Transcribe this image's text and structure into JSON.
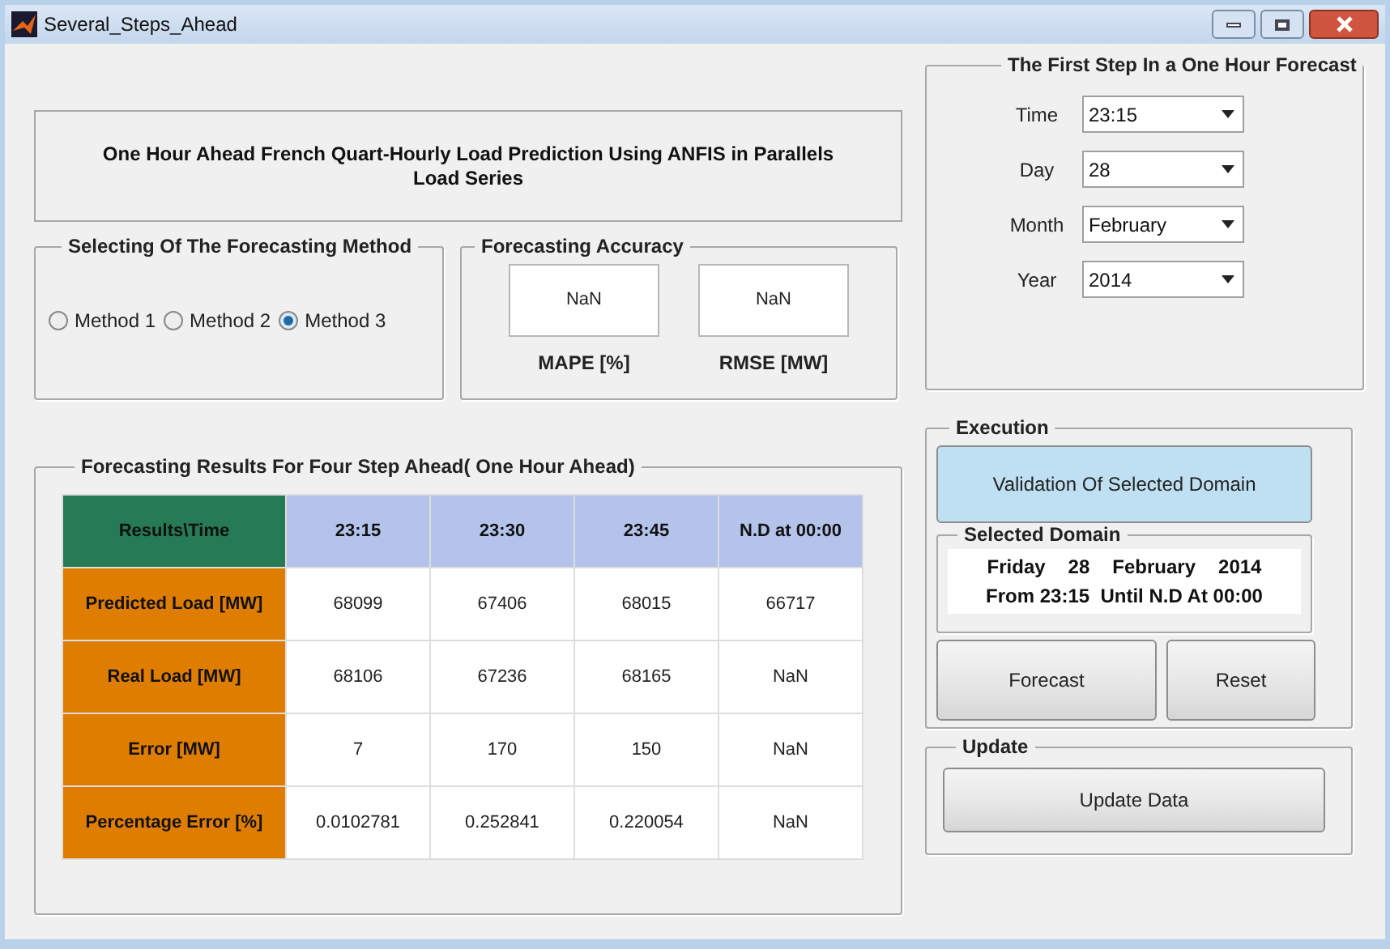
{
  "window": {
    "title": "Several_Steps_Ahead"
  },
  "heading": "One Hour Ahead French Quart-Hourly Load Prediction Using ANFIS in Parallels Load Series",
  "method_group": {
    "title": "Selecting Of The Forecasting Method",
    "options": [
      {
        "label": "Method 1",
        "selected": false
      },
      {
        "label": "Method 2",
        "selected": false
      },
      {
        "label": "Method 3",
        "selected": true
      }
    ]
  },
  "accuracy_group": {
    "title": "Forecasting Accuracy",
    "metrics": [
      {
        "value": "NaN",
        "label": "MAPE [%]"
      },
      {
        "value": "NaN",
        "label": "RMSE [MW]"
      }
    ]
  },
  "results_group": {
    "title": "Forecasting Results For Four Step Ahead( One Hour Ahead)",
    "table": {
      "corner": "Results\\Time",
      "columns": [
        "23:15",
        "23:30",
        "23:45",
        "N.D at 00:00"
      ],
      "rows": [
        {
          "label": "Predicted Load [MW]",
          "cells": [
            "68099",
            "67406",
            "68015",
            "66717"
          ]
        },
        {
          "label": "Real Load [MW]",
          "cells": [
            "68106",
            "67236",
            "68165",
            "NaN"
          ]
        },
        {
          "label": "Error [MW]",
          "cells": [
            "7",
            "170",
            "150",
            "NaN"
          ]
        },
        {
          "label": "Percentage Error [%]",
          "cells": [
            "0.0102781",
            "0.252841",
            "0.220054",
            "NaN"
          ]
        }
      ]
    }
  },
  "first_step_group": {
    "title": "The First Step In a One Hour Forecast",
    "fields": [
      {
        "label": "Time",
        "value": "23:15"
      },
      {
        "label": "Day",
        "value": "28"
      },
      {
        "label": "Month",
        "value": "February"
      },
      {
        "label": "Year",
        "value": "2014"
      }
    ]
  },
  "execution_group": {
    "title": "Execution",
    "validate_button": "Validation Of Selected Domain",
    "domain": {
      "title": "Selected Domain",
      "line_1": [
        "Friday",
        "28",
        "February",
        "2014"
      ],
      "line_2": "From 23:15  Until N.D At 00:00"
    },
    "buttons": [
      "Forecast",
      "Reset"
    ]
  },
  "update_group": {
    "title": "Update",
    "button": "Update Data"
  }
}
